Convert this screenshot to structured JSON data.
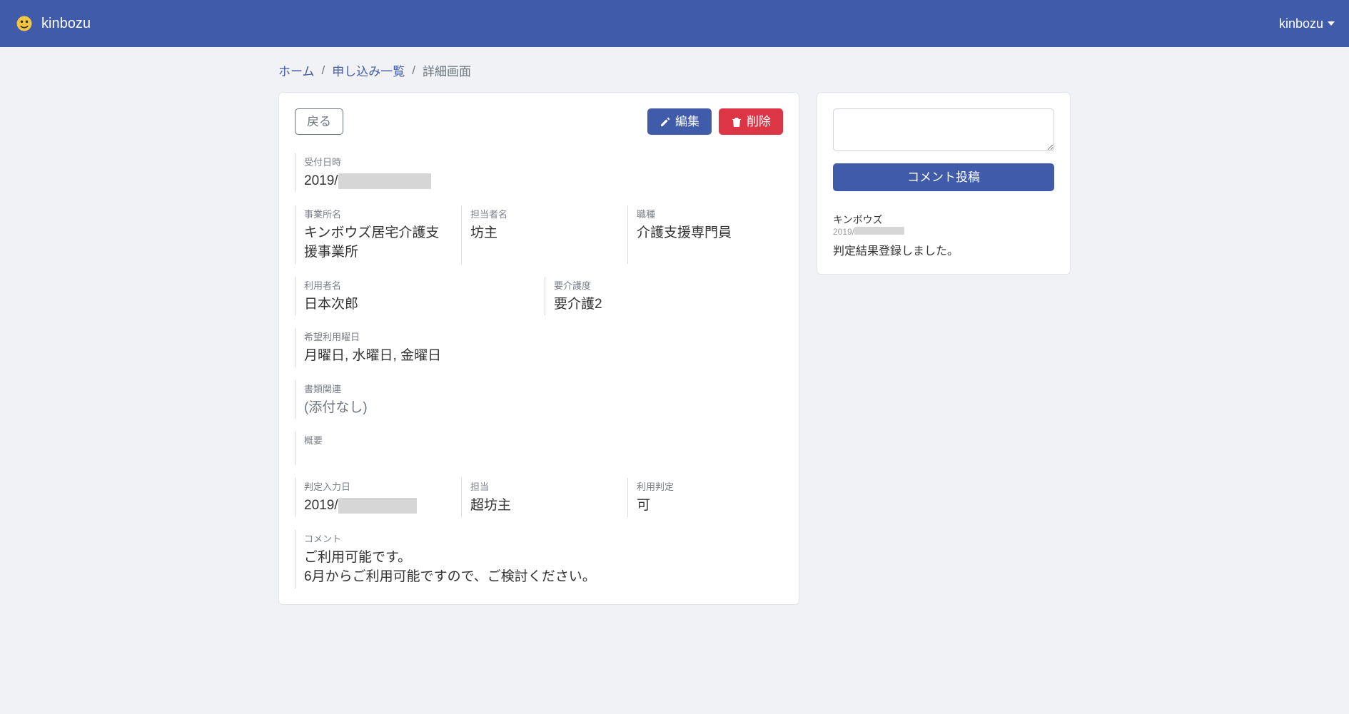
{
  "navbar": {
    "brand": "kinbozu",
    "user": "kinbozu"
  },
  "breadcrumb": {
    "home": "ホーム",
    "list": "申し込み一覧",
    "current": "詳細画面"
  },
  "toolbar": {
    "back": "戻る",
    "edit": "編集",
    "delete": "削除"
  },
  "detail": {
    "received_at_label": "受付日時",
    "received_at_prefix": "2019/",
    "office_label": "事業所名",
    "office_value": "キンボウズ居宅介護支援事業所",
    "contact_label": "担当者名",
    "contact_value": "坊主",
    "role_label": "職種",
    "role_value": "介護支援専門員",
    "user_label": "利用者名",
    "user_value": "日本次郎",
    "carelevel_label": "要介護度",
    "carelevel_value": "要介護2",
    "days_label": "希望利用曜日",
    "days_value": "月曜日, 水曜日, 金曜日",
    "docs_label": "書類関連",
    "docs_value": "(添付なし)",
    "summary_label": "概要",
    "summary_value": "",
    "judged_at_label": "判定入力日",
    "judged_at_prefix": "2019/",
    "judge_by_label": "担当",
    "judge_by_value": "超坊主",
    "judgement_label": "利用判定",
    "judgement_value": "可",
    "comment_label": "コメント",
    "comment_line1": "ご利用可能です。",
    "comment_line2": "6月からご利用可能ですので、ご検討ください。"
  },
  "sidebar": {
    "submit": "コメント投稿",
    "comment": {
      "author": "キンボウズ",
      "date_prefix": "2019/",
      "text": "判定結果登録しました。"
    }
  }
}
